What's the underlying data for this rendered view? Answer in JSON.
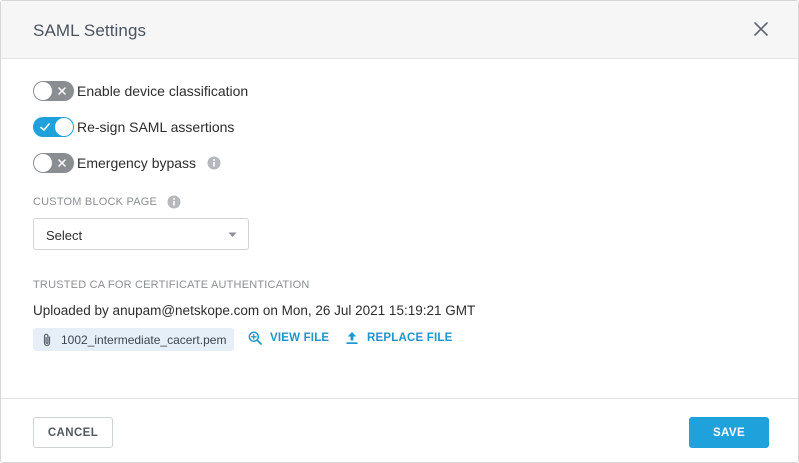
{
  "dialog": {
    "title": "SAML Settings",
    "close_icon": "close-icon"
  },
  "toggles": [
    {
      "label": "Enable device classification",
      "state": "off",
      "icon": "x-icon"
    },
    {
      "label": "Re-sign SAML assertions",
      "state": "on",
      "icon": "check-icon"
    },
    {
      "label": "Emergency bypass",
      "state": "off",
      "icon": "x-icon",
      "info_icon": "info-icon"
    }
  ],
  "custom_block_page": {
    "label": "CUSTOM BLOCK PAGE",
    "info_icon": "info-icon",
    "select_value": "Select",
    "caret_icon": "caret-down-icon"
  },
  "trusted_ca": {
    "label": "TRUSTED CA FOR CERTIFICATE AUTHENTICATION",
    "uploaded_text": "Uploaded by anupam@netskope.com on Mon, 26 Jul 2021 15:19:21 GMT",
    "file_name": "1002_intermediate_cacert.pem",
    "file_icon": "paperclip-icon",
    "view_file_label": "VIEW FILE",
    "view_file_icon": "zoom-in-icon",
    "replace_file_label": "REPLACE FILE",
    "replace_file_icon": "upload-icon"
  },
  "footer": {
    "cancel_label": "CANCEL",
    "save_label": "SAVE"
  },
  "colors": {
    "accent": "#1fa2dc",
    "toggle_off": "#8a8d91",
    "header_bg": "#f6f6f7",
    "chip_bg": "#e6eef7",
    "link": "#1b96cf"
  }
}
